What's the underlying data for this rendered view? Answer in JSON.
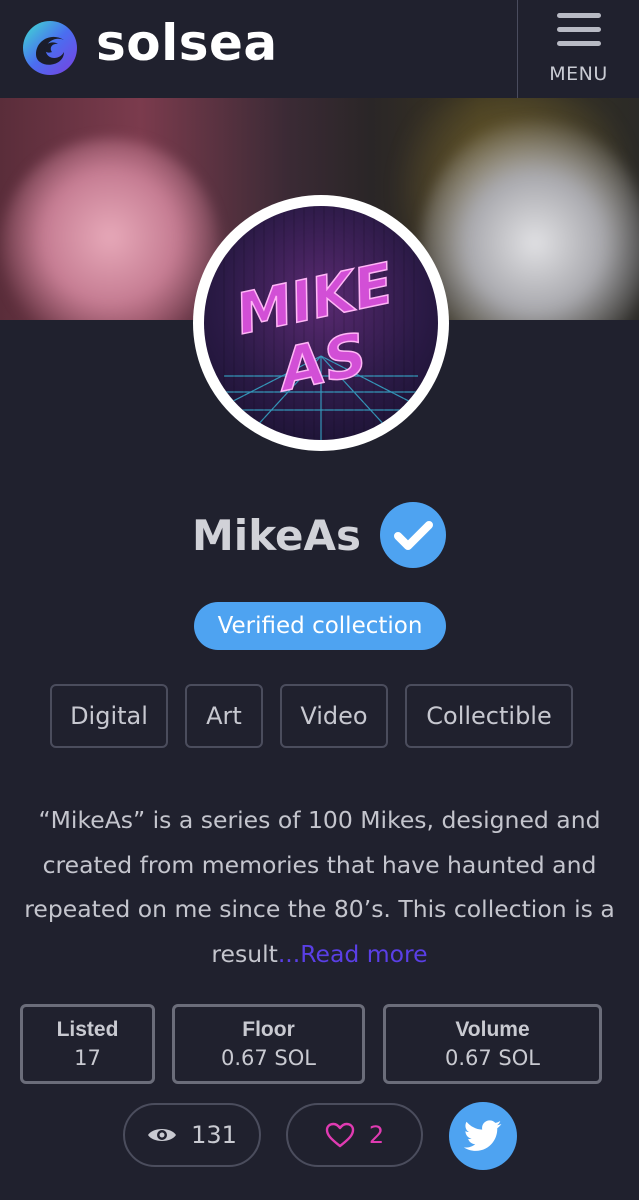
{
  "header": {
    "brand": "solsea",
    "menu_label": "MENU"
  },
  "collection": {
    "name": "MikeAs",
    "avatar_text": [
      "MIKE",
      "AS"
    ],
    "verified_badge": "Verified collection",
    "tags": [
      "Digital",
      "Art",
      "Video",
      "Collectible"
    ],
    "description": "“MikeAs” is a series of 100 Mikes, designed and created from memories that have haunted and repeated on me since the 80’s. This collection is a result",
    "read_more": "...Read more"
  },
  "stats": {
    "listed": {
      "label": "Listed",
      "value": "17"
    },
    "floor": {
      "label": "Floor",
      "value": "0.67 SOL"
    },
    "volume": {
      "label": "Volume",
      "value": "0.67 SOL"
    }
  },
  "social": {
    "views": "131",
    "likes": "2"
  },
  "colors": {
    "background": "#20212e",
    "accent_blue": "#4ea3f1",
    "read_more": "#5a3fe6",
    "like_pink": "#e03bb2"
  },
  "icons": [
    "solsea-logo-icon",
    "hamburger-icon",
    "verified-check-icon",
    "eye-icon",
    "heart-icon",
    "twitter-icon"
  ]
}
